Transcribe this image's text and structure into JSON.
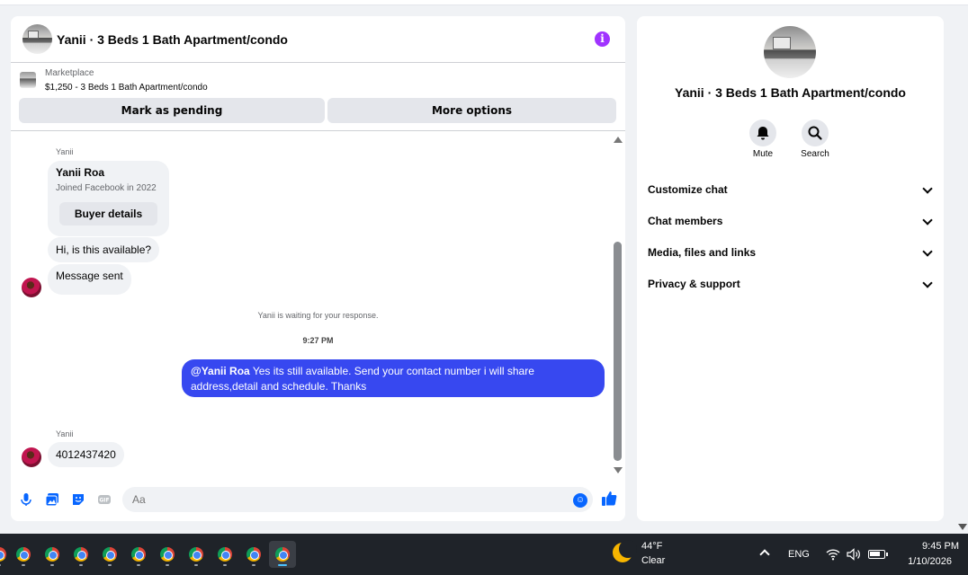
{
  "colors": {
    "accent": "#0866ff",
    "outgoing_bubble": "#3748f0",
    "info_icon": "#a033ff"
  },
  "chat": {
    "header": {
      "title": "Yanii · 3 Beds 1 Bath Apartment/condo",
      "info_icon": "info-icon"
    },
    "marketplace": {
      "label": "Marketplace",
      "listing": "$1,250 - 3 Beds 1 Bath Apartment/condo",
      "mark_pending_label": "Mark as pending",
      "more_options_label": "More options"
    },
    "messages": {
      "first_sender": "Yanii",
      "profile_card": {
        "name": "Yanii Roa",
        "joined": "Joined Facebook in 2022",
        "button_label": "Buyer details"
      },
      "msg1": "Hi, is this available?",
      "msg2": "Message sent",
      "waiting_notice": "Yanii is waiting for your response.",
      "time_divider": "9:27 PM",
      "outgoing": {
        "mention": "@Yanii Roa",
        "text": " Yes its still available. Send your contact number i will share address,detail and schedule. Thanks"
      },
      "second_sender": "Yanii",
      "msg3": "4012437420"
    },
    "composer": {
      "placeholder": "Aa",
      "icons": [
        "microphone-icon",
        "gallery-icon",
        "sticker-icon",
        "gif-icon",
        "emoji-icon",
        "like-icon"
      ]
    }
  },
  "sidebar": {
    "title": "Yanii · 3 Beds 1 Bath Apartment/condo",
    "actions": [
      {
        "label": "Mute",
        "icon": "bell-icon"
      },
      {
        "label": "Search",
        "icon": "search-icon"
      }
    ],
    "sections": [
      "Customize chat",
      "Chat members",
      "Media, files and links",
      "Privacy & support"
    ]
  },
  "taskbar": {
    "weather_temp": "44°F",
    "weather_cond": "Clear",
    "lang": "ENG",
    "time": "9:45 PM",
    "date": "1/10/2026"
  }
}
